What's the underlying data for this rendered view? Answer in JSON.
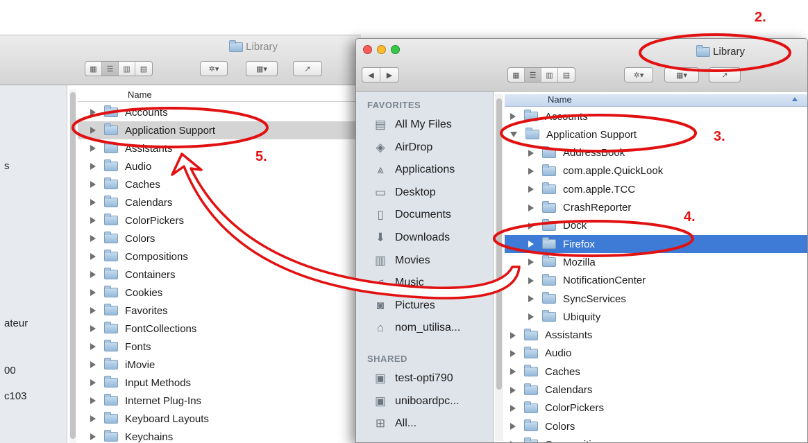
{
  "back_window": {
    "title": "Library",
    "column_header": "Name",
    "sidebar_fragments": [
      "s",
      "ateur",
      "00",
      "c103"
    ],
    "rows": [
      "Accounts",
      "Application Support",
      "Assistants",
      "Audio",
      "Caches",
      "Calendars",
      "ColorPickers",
      "Colors",
      "Compositions",
      "Containers",
      "Cookies",
      "Favorites",
      "FontCollections",
      "Fonts",
      "iMovie",
      "Input Methods",
      "Internet Plug-Ins",
      "Keyboard Layouts",
      "Keychains"
    ]
  },
  "front_window": {
    "title": "Library",
    "column_header": "Name",
    "sidebar": {
      "favorites_heading": "FAVORITES",
      "favorites": [
        {
          "label": "All My Files",
          "icon": "all-files-icon"
        },
        {
          "label": "AirDrop",
          "icon": "airdrop-icon"
        },
        {
          "label": "Applications",
          "icon": "applications-icon"
        },
        {
          "label": "Desktop",
          "icon": "desktop-icon"
        },
        {
          "label": "Documents",
          "icon": "documents-icon"
        },
        {
          "label": "Downloads",
          "icon": "downloads-icon"
        },
        {
          "label": "Movies",
          "icon": "movies-icon"
        },
        {
          "label": "Music",
          "icon": "music-icon"
        },
        {
          "label": "Pictures",
          "icon": "pictures-icon"
        },
        {
          "label": "nom_utilisa...",
          "icon": "home-icon"
        }
      ],
      "shared_heading": "SHARED",
      "shared": [
        {
          "label": "test-opti790",
          "icon": "computer-icon"
        },
        {
          "label": "uniboardpc...",
          "icon": "computer-icon"
        },
        {
          "label": "All...",
          "icon": "network-icon"
        }
      ]
    },
    "rows": [
      {
        "name": "Accounts",
        "level": 0,
        "open": false
      },
      {
        "name": "Application Support",
        "level": 0,
        "open": true
      },
      {
        "name": "AddressBook",
        "level": 1,
        "open": false
      },
      {
        "name": "com.apple.QuickLook",
        "level": 1,
        "open": false
      },
      {
        "name": "com.apple.TCC",
        "level": 1,
        "open": false
      },
      {
        "name": "CrashReporter",
        "level": 1,
        "open": false
      },
      {
        "name": "Dock",
        "level": 1,
        "open": false
      },
      {
        "name": "Firefox",
        "level": 1,
        "open": false,
        "selected": true
      },
      {
        "name": "Mozilla",
        "level": 1,
        "open": false
      },
      {
        "name": "NotificationCenter",
        "level": 1,
        "open": false
      },
      {
        "name": "SyncServices",
        "level": 1,
        "open": false
      },
      {
        "name": "Ubiquity",
        "level": 1,
        "open": false
      },
      {
        "name": "Assistants",
        "level": 0,
        "open": false
      },
      {
        "name": "Audio",
        "level": 0,
        "open": false
      },
      {
        "name": "Caches",
        "level": 0,
        "open": false
      },
      {
        "name": "Calendars",
        "level": 0,
        "open": false
      },
      {
        "name": "ColorPickers",
        "level": 0,
        "open": false
      },
      {
        "name": "Colors",
        "level": 0,
        "open": false
      },
      {
        "name": "Compositions",
        "level": 0,
        "open": false
      }
    ]
  },
  "annotations": [
    "2.",
    "3.",
    "4.",
    "5."
  ],
  "colors": {
    "annotation": "#e21111",
    "selection": "#3d7bd7",
    "sidebar": "#dfe4ea"
  }
}
